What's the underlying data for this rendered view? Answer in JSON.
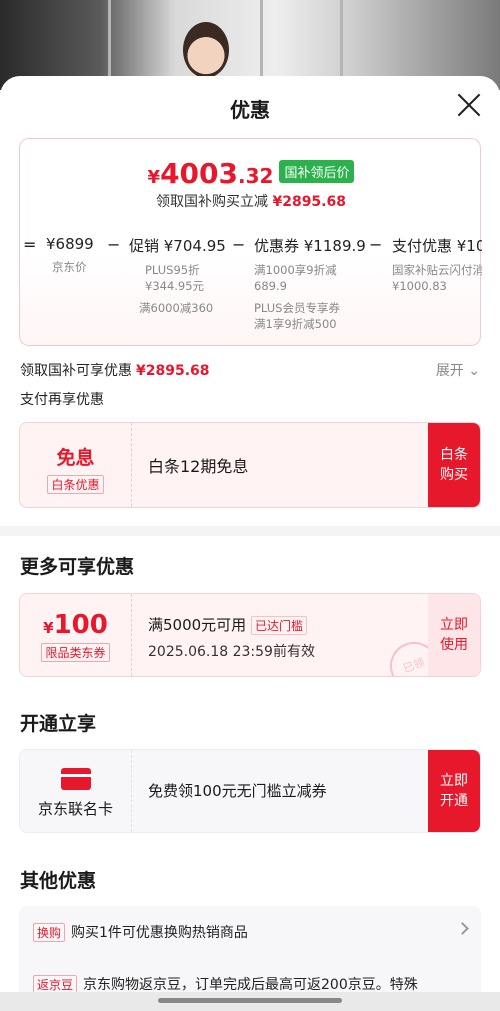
{
  "sheet": {
    "title": "优惠"
  },
  "price": {
    "yen": "¥",
    "int": "4003",
    "dec": ".32",
    "tag": "国补领后价",
    "sub_text": "领取国补购买立减",
    "sub_amount": "¥2895.68"
  },
  "formula": {
    "eq": "=",
    "jd_price": "¥6899",
    "jd_price_label": "京东价",
    "op1": "−",
    "promo": "促销 ¥704.95",
    "promo_n1": "PLUS95折",
    "promo_n2": "¥344.95元",
    "promo_n3": "满6000减360",
    "op2": "−",
    "coupon": "优惠券 ¥1189.9",
    "coupon_n1": "满1000享9折减",
    "coupon_n2": "689.9",
    "coupon_n3": "PLUS会员专享券",
    "coupon_n4": "满1享9折减500",
    "op3": "−",
    "pay": "支付优惠 ¥10",
    "pay_n1": "国家补贴云闪付消",
    "pay_n2": "¥1000.83"
  },
  "claim": {
    "text": "领取国补可享优惠",
    "amount": "¥2895.68",
    "expand": "展开 ⌄"
  },
  "pay_again": "支付再享优惠",
  "baitiao": {
    "title": "免息",
    "badge": "白条优惠",
    "desc": "白条12期免息",
    "btn_1": "白条",
    "btn_2": "购买"
  },
  "more": {
    "heading": "更多可享优惠",
    "coupon_yen": "¥",
    "coupon_value": "100",
    "coupon_badge": "限品类东券",
    "cond": "满5000元可用",
    "cond_tag": "已达门槛",
    "expiry": "2025.06.18 23:59前有效",
    "btn_1": "立即",
    "btn_2": "使用",
    "stamp": "已领"
  },
  "open": {
    "heading": "开通立享",
    "card_name": "京东联名卡",
    "desc": "免费领100元无门槛立减券",
    "btn_1": "立即",
    "btn_2": "开通"
  },
  "other": {
    "heading": "其他优惠",
    "row1_label": "换购",
    "row1_text": "购买1件可优惠换购热销商品",
    "row2_label": "返京豆",
    "row2_text": "京东购物返京豆，订单完成后最高可返200京豆。特殊"
  },
  "colors": {
    "accent": "#e8182c",
    "green_tag": "#2bb24c"
  }
}
